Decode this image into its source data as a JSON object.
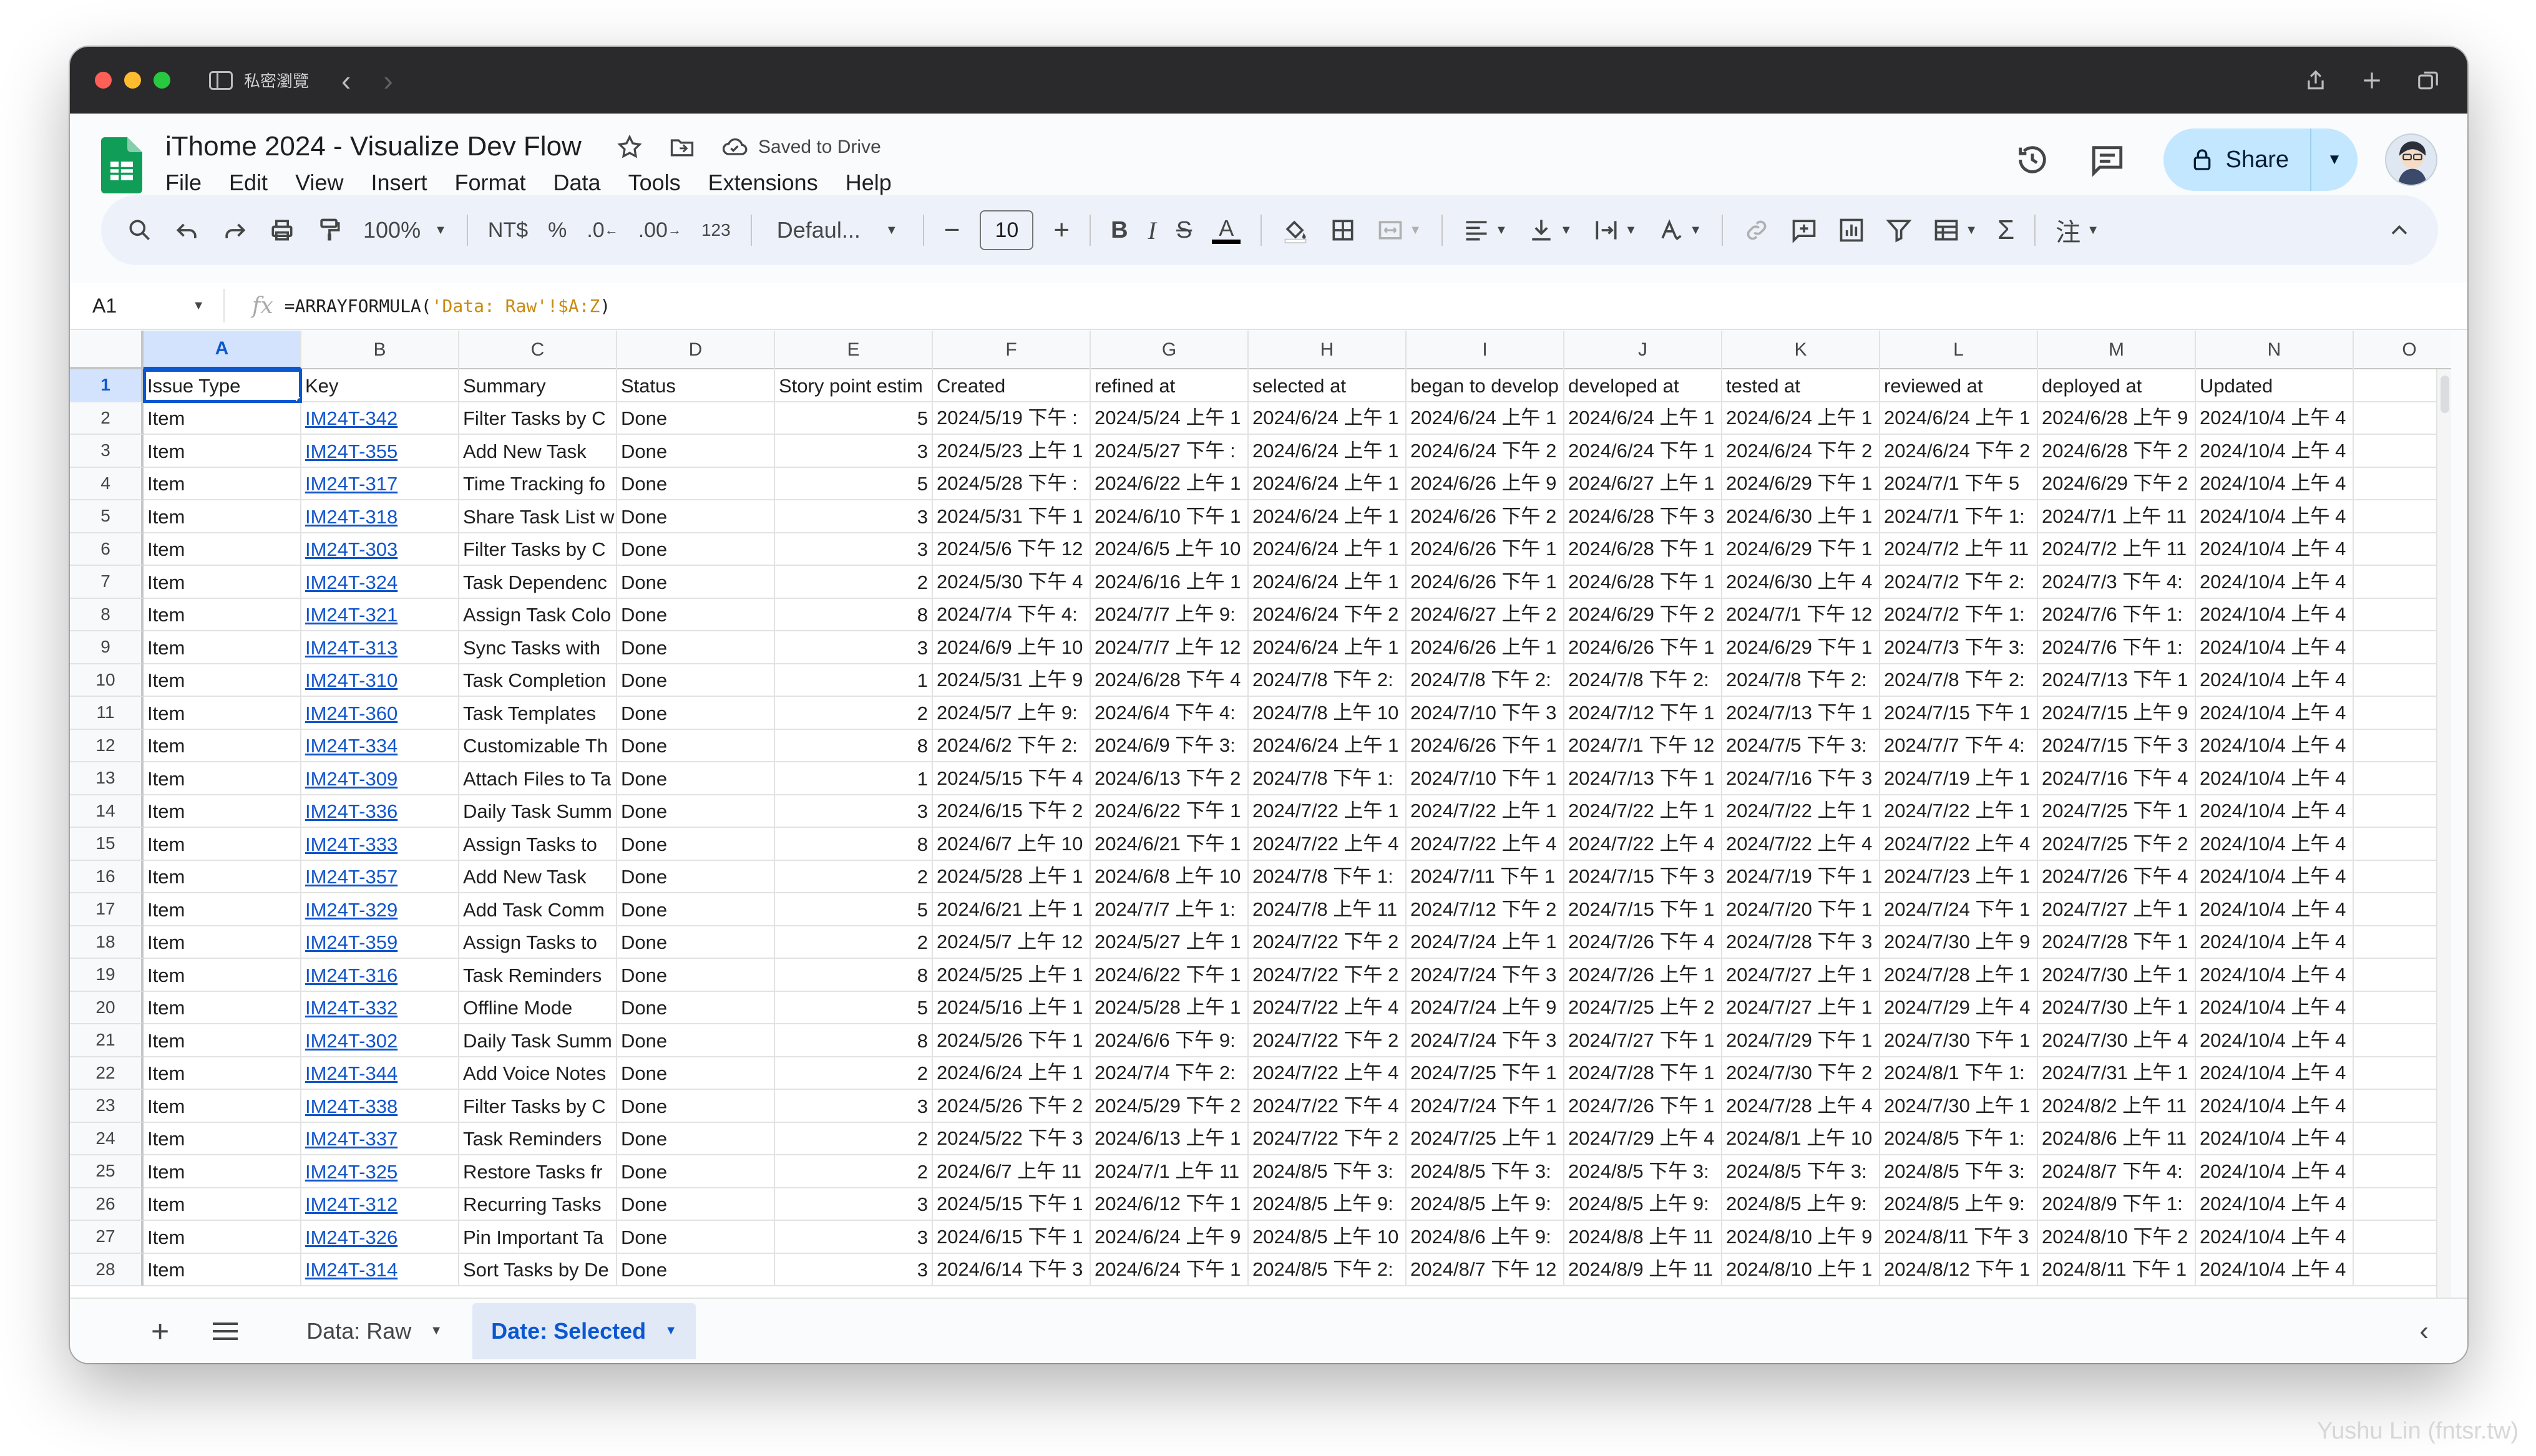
{
  "browser": {
    "private_label": "私密瀏覽"
  },
  "document": {
    "title": "iThome 2024 - Visualize Dev Flow",
    "save_status": "Saved to Drive",
    "share_label": "Share"
  },
  "menu": [
    "File",
    "Edit",
    "View",
    "Insert",
    "Format",
    "Data",
    "Tools",
    "Extensions",
    "Help"
  ],
  "toolbar": {
    "zoom": "100%",
    "currency": "NT$",
    "percent": "%",
    "decrease_decimal": ".0",
    "increase_decimal": ".00",
    "number_format": "123",
    "font": "Defaul...",
    "font_size": "10"
  },
  "formula_bar": {
    "cell_ref": "A1",
    "formula_prefix": "=ARRAYFORMULA(",
    "formula_string": "'Data: Raw'!$A:Z",
    "formula_suffix": ")"
  },
  "columns": [
    "A",
    "B",
    "C",
    "D",
    "E",
    "F",
    "G",
    "H",
    "I",
    "J",
    "K",
    "L",
    "M",
    "N",
    "O"
  ],
  "rows": [
    [
      "Issue Type",
      "Key",
      "Summary",
      "Status",
      "Story point estim",
      "Created",
      "refined at",
      "selected at",
      "began to develop",
      "developed at",
      "tested at",
      "reviewed at",
      "deployed at",
      "Updated"
    ],
    [
      "Item",
      "IM24T-342",
      "Filter Tasks by C",
      "Done",
      "5",
      "2024/5/19 下午 :",
      "2024/5/24 上午 1",
      "2024/6/24 上午 1",
      "2024/6/24 上午 1",
      "2024/6/24 上午 1",
      "2024/6/24 上午 1",
      "2024/6/24 上午 1",
      "2024/6/28 上午 9",
      "2024/10/4 上午 4"
    ],
    [
      "Item",
      "IM24T-355",
      "Add New Task",
      "Done",
      "3",
      "2024/5/23 上午 1",
      "2024/5/27 下午 :",
      "2024/6/24 上午 1",
      "2024/6/24 下午 2",
      "2024/6/24 下午 1",
      "2024/6/24 下午 2",
      "2024/6/24 下午 2",
      "2024/6/28 下午 2",
      "2024/10/4 上午 4"
    ],
    [
      "Item",
      "IM24T-317",
      "Time Tracking fo",
      "Done",
      "5",
      "2024/5/28 下午 :",
      "2024/6/22 上午 1",
      "2024/6/24 上午 1",
      "2024/6/26 上午 9",
      "2024/6/27 上午 1",
      "2024/6/29 下午 1",
      "2024/7/1 下午 5",
      "2024/6/29 下午 2",
      "2024/10/4 上午 4"
    ],
    [
      "Item",
      "IM24T-318",
      "Share Task List w",
      "Done",
      "3",
      "2024/5/31 下午 1",
      "2024/6/10 下午 1",
      "2024/6/24 上午 1",
      "2024/6/26 下午 2",
      "2024/6/28 下午 3",
      "2024/6/30 上午 1",
      "2024/7/1 下午 1:",
      "2024/7/1 上午 11",
      "2024/10/4 上午 4"
    ],
    [
      "Item",
      "IM24T-303",
      "Filter Tasks by C",
      "Done",
      "3",
      "2024/5/6 下午 12",
      "2024/6/5 上午 10",
      "2024/6/24 上午 1",
      "2024/6/26 下午 1",
      "2024/6/28 下午 1",
      "2024/6/29 下午 1",
      "2024/7/2 上午 11",
      "2024/7/2 上午 11",
      "2024/10/4 上午 4"
    ],
    [
      "Item",
      "IM24T-324",
      "Task Dependenc",
      "Done",
      "2",
      "2024/5/30 下午 4",
      "2024/6/16 上午 1",
      "2024/6/24 上午 1",
      "2024/6/26 下午 1",
      "2024/6/28 下午 1",
      "2024/6/30 上午 4",
      "2024/7/2 下午 2:",
      "2024/7/3 下午 4:",
      "2024/10/4 上午 4"
    ],
    [
      "Item",
      "IM24T-321",
      "Assign Task Colo",
      "Done",
      "8",
      "2024/7/4 下午 4:",
      "2024/7/7 上午 9:",
      "2024/6/24 下午 2",
      "2024/6/27 上午 2",
      "2024/6/29 下午 2",
      "2024/7/1 下午 12",
      "2024/7/2 下午 1:",
      "2024/7/6 下午 1:",
      "2024/10/4 上午 4"
    ],
    [
      "Item",
      "IM24T-313",
      "Sync Tasks with",
      "Done",
      "3",
      "2024/6/9 上午 10",
      "2024/7/7 上午 12",
      "2024/6/24 上午 1",
      "2024/6/26 上午 1",
      "2024/6/26 下午 1",
      "2024/6/29 下午 1",
      "2024/7/3 下午 3:",
      "2024/7/6 下午 1:",
      "2024/10/4 上午 4"
    ],
    [
      "Item",
      "IM24T-310",
      "Task Completion",
      "Done",
      "1",
      "2024/5/31 上午 9",
      "2024/6/28 下午 4",
      "2024/7/8 下午 2:",
      "2024/7/8 下午 2:",
      "2024/7/8 下午 2:",
      "2024/7/8 下午 2:",
      "2024/7/8 下午 2:",
      "2024/7/13 下午 1",
      "2024/10/4 上午 4"
    ],
    [
      "Item",
      "IM24T-360",
      "Task Templates",
      "Done",
      "2",
      "2024/5/7 上午 9:",
      "2024/6/4 下午 4:",
      "2024/7/8 上午 10",
      "2024/7/10 下午 3",
      "2024/7/12 下午 1",
      "2024/7/13 下午 1",
      "2024/7/15 下午 1",
      "2024/7/15 上午 9",
      "2024/10/4 上午 4"
    ],
    [
      "Item",
      "IM24T-334",
      "Customizable Th",
      "Done",
      "8",
      "2024/6/2 下午 2:",
      "2024/6/9 下午 3:",
      "2024/6/24 上午 1",
      "2024/6/26 下午 1",
      "2024/7/1 下午 12",
      "2024/7/5 下午 3:",
      "2024/7/7 下午 4:",
      "2024/7/15 下午 3",
      "2024/10/4 上午 4"
    ],
    [
      "Item",
      "IM24T-309",
      "Attach Files to Ta",
      "Done",
      "1",
      "2024/5/15 下午 4",
      "2024/6/13 下午 2",
      "2024/7/8 下午 1:",
      "2024/7/10 下午 1",
      "2024/7/13 下午 1",
      "2024/7/16 下午 3",
      "2024/7/19 上午 1",
      "2024/7/16 下午 4",
      "2024/10/4 上午 4"
    ],
    [
      "Item",
      "IM24T-336",
      "Daily Task Summ",
      "Done",
      "3",
      "2024/6/15 下午 2",
      "2024/6/22 下午 1",
      "2024/7/22 上午 1",
      "2024/7/22 上午 1",
      "2024/7/22 上午 1",
      "2024/7/22 上午 1",
      "2024/7/22 上午 1",
      "2024/7/25 下午 1",
      "2024/10/4 上午 4"
    ],
    [
      "Item",
      "IM24T-333",
      "Assign Tasks to",
      "Done",
      "8",
      "2024/6/7 上午 10",
      "2024/6/21 下午 1",
      "2024/7/22 上午 4",
      "2024/7/22 上午 4",
      "2024/7/22 上午 4",
      "2024/7/22 上午 4",
      "2024/7/22 上午 4",
      "2024/7/25 下午 2",
      "2024/10/4 上午 4"
    ],
    [
      "Item",
      "IM24T-357",
      "Add New Task",
      "Done",
      "2",
      "2024/5/28 上午 1",
      "2024/6/8 上午 10",
      "2024/7/8 下午 1:",
      "2024/7/11 下午 1",
      "2024/7/15 下午 3",
      "2024/7/19 下午 1",
      "2024/7/23 上午 1",
      "2024/7/26 下午 4",
      "2024/10/4 上午 4"
    ],
    [
      "Item",
      "IM24T-329",
      "Add Task Comm",
      "Done",
      "5",
      "2024/6/21 上午 1",
      "2024/7/7 上午 1:",
      "2024/7/8 上午 11",
      "2024/7/12 下午 2",
      "2024/7/15 下午 1",
      "2024/7/20 下午 1",
      "2024/7/24 下午 1",
      "2024/7/27 上午 1",
      "2024/10/4 上午 4"
    ],
    [
      "Item",
      "IM24T-359",
      "Assign Tasks to",
      "Done",
      "2",
      "2024/5/7 上午 12",
      "2024/5/27 上午 1",
      "2024/7/22 下午 2",
      "2024/7/24 上午 1",
      "2024/7/26 下午 4",
      "2024/7/28 下午 3",
      "2024/7/30 上午 9",
      "2024/7/28 下午 1",
      "2024/10/4 上午 4"
    ],
    [
      "Item",
      "IM24T-316",
      "Task Reminders",
      "Done",
      "8",
      "2024/5/25 上午 1",
      "2024/6/22 下午 1",
      "2024/7/22 下午 2",
      "2024/7/24 下午 3",
      "2024/7/26 上午 1",
      "2024/7/27 上午 1",
      "2024/7/28 上午 1",
      "2024/7/30 上午 1",
      "2024/10/4 上午 4"
    ],
    [
      "Item",
      "IM24T-332",
      "Offline Mode",
      "Done",
      "5",
      "2024/5/16 上午 1",
      "2024/5/28 上午 1",
      "2024/7/22 上午 4",
      "2024/7/24 上午 9",
      "2024/7/25 上午 2",
      "2024/7/27 上午 1",
      "2024/7/29 上午 4",
      "2024/7/30 上午 1",
      "2024/10/4 上午 4"
    ],
    [
      "Item",
      "IM24T-302",
      "Daily Task Summ",
      "Done",
      "8",
      "2024/5/26 下午 1",
      "2024/6/6 下午 9:",
      "2024/7/22 下午 2",
      "2024/7/24 下午 3",
      "2024/7/27 下午 1",
      "2024/7/29 下午 1",
      "2024/7/30 下午 1",
      "2024/7/30 上午 4",
      "2024/10/4 上午 4"
    ],
    [
      "Item",
      "IM24T-344",
      "Add Voice Notes",
      "Done",
      "2",
      "2024/6/24 上午 1",
      "2024/7/4 下午 2:",
      "2024/7/22 上午 4",
      "2024/7/25 下午 1",
      "2024/7/28 下午 1",
      "2024/7/30 下午 2",
      "2024/8/1 下午 1:",
      "2024/7/31 上午 1",
      "2024/10/4 上午 4"
    ],
    [
      "Item",
      "IM24T-338",
      "Filter Tasks by C",
      "Done",
      "3",
      "2024/5/26 下午 2",
      "2024/5/29 下午 2",
      "2024/7/22 下午 4",
      "2024/7/24 下午 1",
      "2024/7/26 下午 1",
      "2024/7/28 上午 4",
      "2024/7/30 上午 1",
      "2024/8/2 上午 11",
      "2024/10/4 上午 4"
    ],
    [
      "Item",
      "IM24T-337",
      "Task Reminders",
      "Done",
      "2",
      "2024/5/22 下午 3",
      "2024/6/13 上午 1",
      "2024/7/22 下午 2",
      "2024/7/25 上午 1",
      "2024/7/29 上午 4",
      "2024/8/1 上午 10",
      "2024/8/5 下午 1:",
      "2024/8/6 上午 11",
      "2024/10/4 上午 4"
    ],
    [
      "Item",
      "IM24T-325",
      "Restore Tasks fr",
      "Done",
      "2",
      "2024/6/7 上午 11",
      "2024/7/1 上午 11",
      "2024/8/5 下午 3:",
      "2024/8/5 下午 3:",
      "2024/8/5 下午 3:",
      "2024/8/5 下午 3:",
      "2024/8/5 下午 3:",
      "2024/8/7 下午 4:",
      "2024/10/4 上午 4"
    ],
    [
      "Item",
      "IM24T-312",
      "Recurring Tasks",
      "Done",
      "3",
      "2024/5/15 下午 1",
      "2024/6/12 下午 1",
      "2024/8/5 上午 9:",
      "2024/8/5 上午 9:",
      "2024/8/5 上午 9:",
      "2024/8/5 上午 9:",
      "2024/8/5 上午 9:",
      "2024/8/9 下午 1:",
      "2024/10/4 上午 4"
    ],
    [
      "Item",
      "IM24T-326",
      "Pin Important Ta",
      "Done",
      "3",
      "2024/6/15 下午 1",
      "2024/6/24 上午 9",
      "2024/8/5 上午 10",
      "2024/8/6 上午 9:",
      "2024/8/8 上午 11",
      "2024/8/10 上午 9",
      "2024/8/11 下午 3",
      "2024/8/10 下午 2",
      "2024/10/4 上午 4"
    ],
    [
      "Item",
      "IM24T-314",
      "Sort Tasks by De",
      "Done",
      "3",
      "2024/6/14 下午 3",
      "2024/6/24 下午 1",
      "2024/8/5 下午 2:",
      "2024/8/7 下午 12",
      "2024/8/9 上午 11",
      "2024/8/10 上午 1",
      "2024/8/12 下午 1",
      "2024/8/11 下午 1",
      "2024/10/4 上午 4"
    ]
  ],
  "sheet_tabs": {
    "tab1": "Data: Raw",
    "tab2": "Date: Selected"
  },
  "watermark": "Yushu Lin (fntsr.tw)"
}
